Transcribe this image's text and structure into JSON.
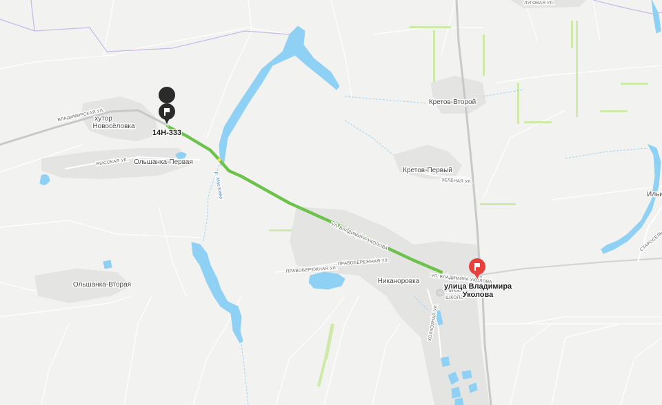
{
  "map": {
    "route": {
      "start_label": "14Н-333",
      "end_label_line1": "улица Владимира",
      "end_label_line2": "Уколова",
      "route_color": "#6cc24a",
      "end_marker_color": "#e8413b",
      "start_marker_color": "#2b2b2b"
    },
    "places": {
      "khutor_line1": "хутор",
      "khutor_line2": "Новосёловка",
      "olshanka_1": "Ольшанка-Первая",
      "olshanka_2": "Ольшанка-Вторая",
      "kretov_1": "Кретов-Первый",
      "kretov_2": "Кретов-Второй",
      "nikanorovka": "Никаноровка",
      "ilyin": "Ильин"
    },
    "streets": {
      "vladimirskaya": "ВЛАДИМИРСКАЯ УЛ.",
      "vysokaya": "ВЫСОКАЯ УЛ.",
      "ukolova_main": "УЛ. ВЛАДИМИРА УКОЛОВА",
      "ukolova_end": "УЛ. ВЛАДИМИРА УКОЛОВА",
      "pravoberezhnaya_1": "ПРАВОБЕРЕЖНАЯ УЛ.",
      "pravoberezhnaya_2": "ПРАВОБЕРЕЖНАЯ УЛ.",
      "zelenaya": "ЗЕЛЁНАЯ УЛ.",
      "lugovaya": "ЛУГОВАЯ УЛ.",
      "kolkhoznaya": "КОЛХОЗНАЯ УЛ.",
      "starosel": "СТАРОСЕЛЬ"
    },
    "river": "р. Масловка",
    "poi": {
      "school_line1": "Никан",
      "school_line2": "школа"
    },
    "colors": {
      "water": "#8fd0f5",
      "field_stripe": "#cfeaa8",
      "settlement": "#e6e6e6",
      "road": "#c9c9c9",
      "boundary": "#c9b8e8"
    }
  }
}
